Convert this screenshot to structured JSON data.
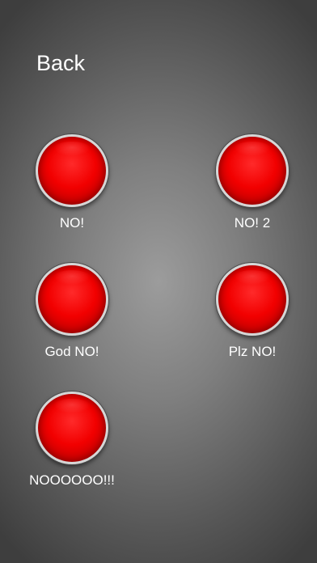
{
  "nav": {
    "back_label": "Back"
  },
  "sounds": [
    {
      "label": "NO!"
    },
    {
      "label": "NO! 2"
    },
    {
      "label": "God NO!"
    },
    {
      "label": "Plz NO!"
    },
    {
      "label": "NOOOOOO!!!"
    }
  ],
  "colors": {
    "button_red": "#f20000",
    "button_rim": "#d6d6d6",
    "text": "#ffffff"
  }
}
